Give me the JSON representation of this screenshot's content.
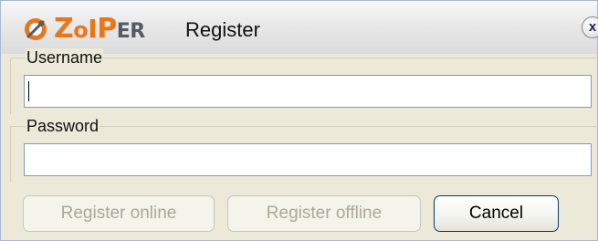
{
  "window": {
    "brand_logo": "ZoIPer",
    "title": "Register",
    "close_glyph": "x"
  },
  "form": {
    "username": {
      "label": "Username",
      "value": ""
    },
    "password": {
      "label": "Password",
      "value": ""
    }
  },
  "buttons": {
    "register_online": "Register online",
    "register_offline": "Register offline",
    "cancel": "Cancel"
  },
  "colors": {
    "brand_orange": "#e8771b",
    "window_bg": "#ece9d8",
    "disabled_text": "#aca899"
  },
  "icons": {
    "logo": "zoiper-logo-icon",
    "close": "close-icon"
  }
}
